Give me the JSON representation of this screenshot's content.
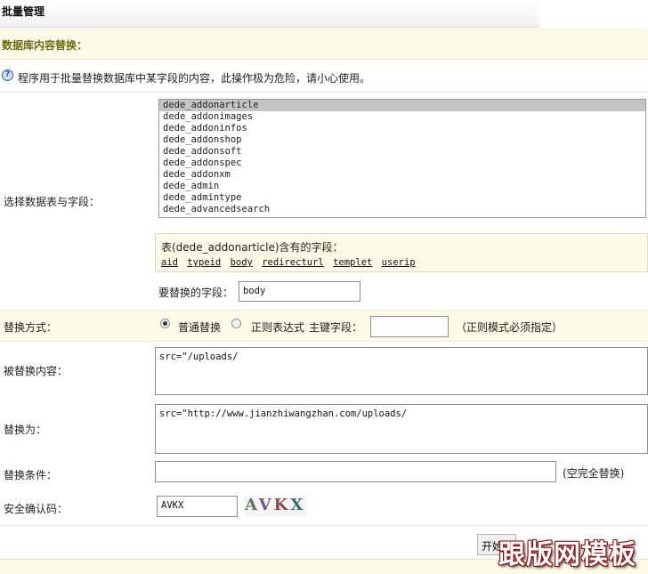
{
  "header": {
    "title": "批量管理"
  },
  "section": {
    "title": "数据库内容替换："
  },
  "notice": {
    "icon": "info-icon",
    "text": "程序用于批量替换数据库中某字段的内容，此操作极为危险，请小心使用。"
  },
  "table_select": {
    "label": "选择数据表与字段：",
    "options": [
      "dede_addonarticle",
      "dede_addonimages",
      "dede_addoninfos",
      "dede_addonshop",
      "dede_addonsoft",
      "dede_addonspec",
      "dede_addonxm",
      "dede_admin",
      "dede_admintype",
      "dede_advancedsearch"
    ],
    "selected": "dede_addonarticle"
  },
  "fields_box": {
    "caption": "表(dede_addonarticle)含有的字段：",
    "fields": [
      "aid",
      "typeid",
      "body",
      "redirecturl",
      "templet",
      "userip"
    ]
  },
  "target_field": {
    "label": "要替换的字段：",
    "value": "body"
  },
  "replace_mode": {
    "label": "替换方式：",
    "normal": "普通替换",
    "regex": "正则表达式",
    "primary_key_label": "主键字段：",
    "primary_key_value": "",
    "hint": "（正则模式必须指定）",
    "selected": "normal"
  },
  "find_content": {
    "label": "被替换内容：",
    "value": "src=\"/uploads/"
  },
  "replace_with": {
    "label": "替换为：",
    "value": "src=\"http://www.jianzhiwangzhan.com/uploads/"
  },
  "condition": {
    "label": "替换条件：",
    "value": "",
    "hint": "(空完全替换)"
  },
  "captcha": {
    "label": "安全确认码：",
    "value": "AVKX",
    "image_text": [
      "A",
      "V",
      "K",
      "X"
    ]
  },
  "submit": {
    "label": "开始"
  },
  "watermark": {
    "text": "跟版网模板"
  }
}
